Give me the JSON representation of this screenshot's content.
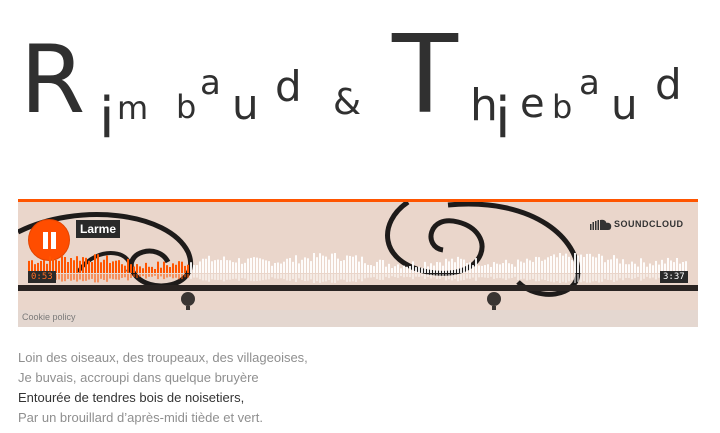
{
  "logo": {
    "letters": [
      "R",
      "i",
      "m",
      "b",
      "a",
      "u",
      "d",
      "&",
      "T",
      "h",
      "i",
      "e",
      "b",
      "a",
      "u",
      "d"
    ]
  },
  "player": {
    "track_title": "Larme",
    "brand": "SOUNDCLOUD",
    "current_time": "0:53",
    "duration": "3:37",
    "progress": 0.244,
    "cookie_policy": "Cookie policy",
    "colors": {
      "accent": "#ff5500",
      "played": "#ff5500",
      "unplayed": "#ffffff"
    },
    "icons": [
      "pause-icon",
      "soundcloud-logo-icon"
    ]
  },
  "poem": {
    "lines": [
      {
        "text": "Loin des oiseaux, des troupeaux, des villageoises,"
      },
      {
        "text": "Je buvais, accroupi dans quelque bruyère"
      },
      {
        "emphasis": "Entourée",
        "text": " de tendres bois de noisetiers,"
      },
      {
        "text": "Par un brouillard d’après-midi tiède et vert."
      }
    ]
  }
}
